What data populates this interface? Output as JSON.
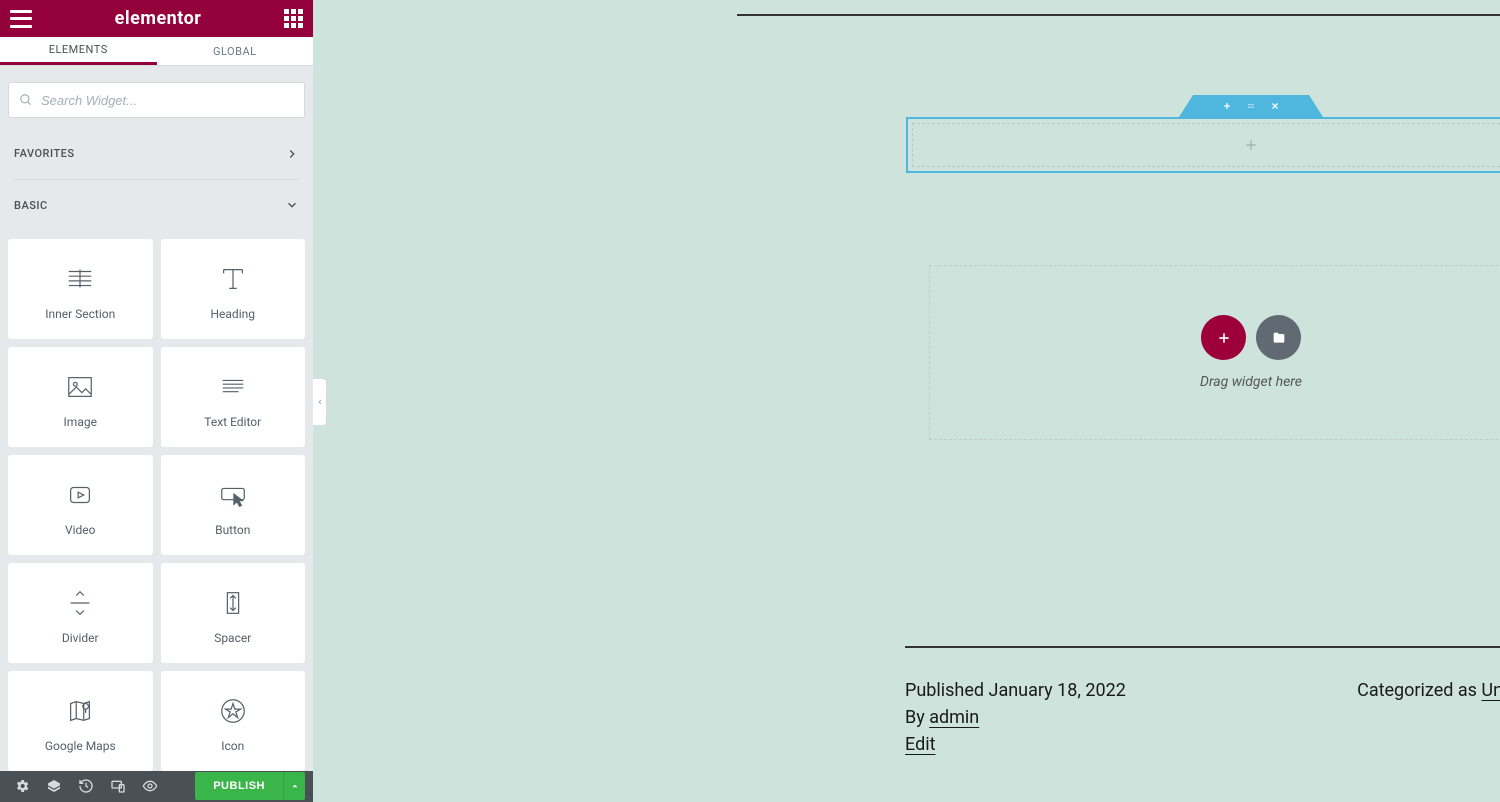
{
  "header": {
    "logo": "elementor"
  },
  "tabs": {
    "elements": "ELEMENTS",
    "global": "GLOBAL"
  },
  "search": {
    "placeholder": "Search Widget..."
  },
  "sections": {
    "favorites": "FAVORITES",
    "basic": "BASIC"
  },
  "widgets": {
    "innerSection": "Inner Section",
    "heading": "Heading",
    "image": "Image",
    "textEditor": "Text Editor",
    "video": "Video",
    "button": "Button",
    "divider": "Divider",
    "spacer": "Spacer",
    "googleMaps": "Google Maps",
    "icon": "Icon"
  },
  "footer": {
    "publish": "PUBLISH"
  },
  "canvas": {
    "dropText": "Drag widget here"
  },
  "meta": {
    "publishedPrefix": "Published ",
    "publishedDate": "January 18, 2022",
    "byPrefix": "By ",
    "byAuthor": "admin",
    "edit": "Edit",
    "categorizedPrefix": "Categorized as ",
    "category": "Uncategorized"
  }
}
